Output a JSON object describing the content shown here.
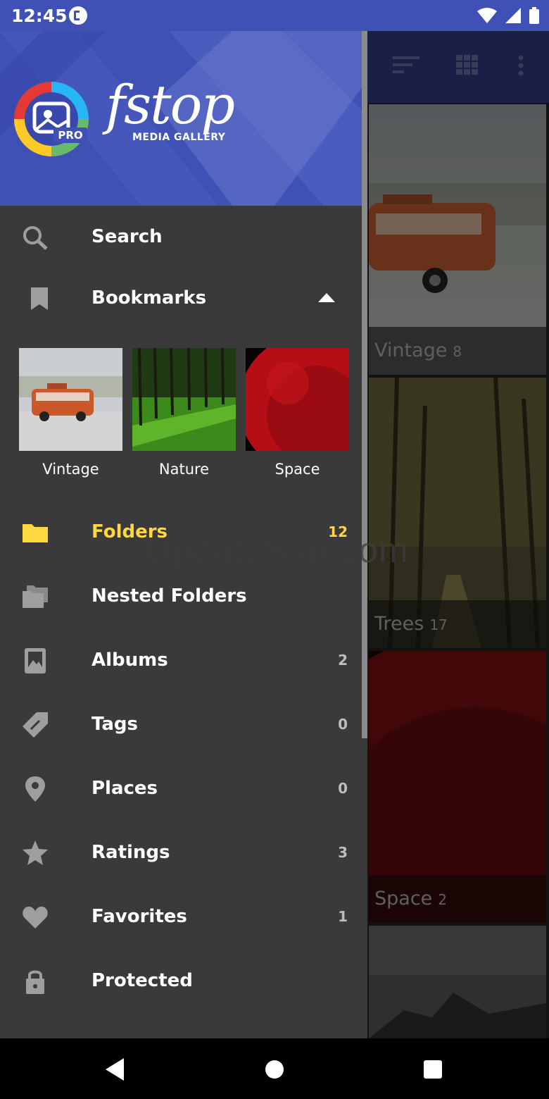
{
  "status_bar": {
    "time": "12:45"
  },
  "drawer": {
    "logo": {
      "word": "fstop",
      "subtitle": "MEDIA GALLERY",
      "badge": "PRO"
    },
    "search_label": "Search",
    "bookmarks_label": "Bookmarks",
    "bookmarks": [
      {
        "label": "Vintage"
      },
      {
        "label": "Nature"
      },
      {
        "label": "Space"
      }
    ],
    "items": [
      {
        "label": "Folders",
        "count": "12",
        "icon": "folder-icon"
      },
      {
        "label": "Nested Folders",
        "count": "",
        "icon": "nested-folders-icon"
      },
      {
        "label": "Albums",
        "count": "2",
        "icon": "album-icon"
      },
      {
        "label": "Tags",
        "count": "0",
        "icon": "tag-icon"
      },
      {
        "label": "Places",
        "count": "0",
        "icon": "place-pin-icon"
      },
      {
        "label": "Ratings",
        "count": "3",
        "icon": "star-icon"
      },
      {
        "label": "Favorites",
        "count": "1",
        "icon": "heart-icon"
      },
      {
        "label": "Protected",
        "count": "",
        "icon": "lock-icon"
      }
    ]
  },
  "gallery": {
    "tiles": [
      {
        "name": "Vintage",
        "count": "8"
      },
      {
        "name": "Trees",
        "count": "17"
      },
      {
        "name": "Space",
        "count": "2"
      }
    ]
  },
  "watermark": "UpdateStar.com",
  "colors": {
    "accent": "#3f51b5",
    "selected": "#ffd740",
    "drawer_bg": "#3a3a3a"
  }
}
